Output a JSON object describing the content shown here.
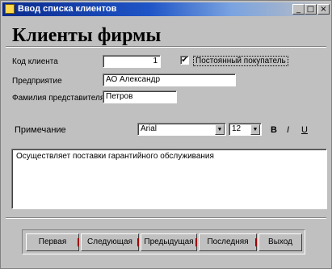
{
  "window": {
    "title": "Ввод списка клиентов",
    "min_glyph": "_",
    "max_glyph": "□",
    "close_glyph": "×"
  },
  "heading": "Клиенты фирмы",
  "form": {
    "client_code_label": "Код клиента",
    "client_code_value": "1",
    "regular_customer_label": "Постоянный покупатель",
    "regular_customer_checked": true,
    "check_glyph": "✔",
    "company_label": "Предприятие",
    "company_value": "АО Александр",
    "rep_name_label": "Фамилия представителя",
    "rep_name_value": "Петров"
  },
  "notes": {
    "label": "Примечание",
    "font_value": "Arial",
    "size_value": "12",
    "bold_label": "B",
    "italic_label": "I",
    "underline_label": "U",
    "dropdown_glyph": "▼",
    "text": "Осуществляет поставки гарантийного обслуживания"
  },
  "nav": {
    "first": "Первая",
    "next": "Следующая",
    "prev": "Предыдущая",
    "last": "Последняя",
    "exit": "Выход"
  }
}
